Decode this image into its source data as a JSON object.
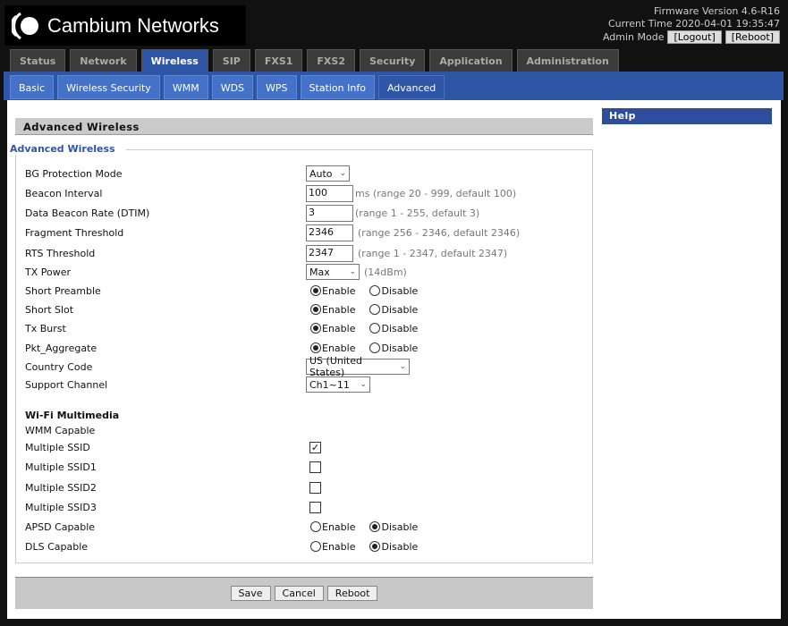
{
  "brand": {
    "name": "Cambium Networks"
  },
  "header": {
    "firmware": "Firmware Version 4.6-R16",
    "time": "Current Time 2020-04-01 19:35:47",
    "mode": "Admin Mode",
    "logout": "[Logout]",
    "reboot": "[Reboot]"
  },
  "tabs": [
    "Status",
    "Network",
    "Wireless",
    "SIP",
    "FXS1",
    "FXS2",
    "Security",
    "Application",
    "Administration"
  ],
  "active_tab": "Wireless",
  "subtabs": [
    "Basic",
    "Wireless Security",
    "WMM",
    "WDS",
    "WPS",
    "Station Info",
    "Advanced"
  ],
  "active_subtab": "Advanced",
  "section_title": "Advanced Wireless",
  "help_title": "Help",
  "fieldset_legend": "Advanced Wireless",
  "fields": {
    "bg_protection": {
      "label": "BG Protection Mode",
      "value": "Auto"
    },
    "beacon_interval": {
      "label": "Beacon Interval",
      "value": "100",
      "hint": "ms (range 20 - 999, default 100)"
    },
    "dtim": {
      "label": "Data Beacon Rate (DTIM)",
      "value": "3",
      "hint": "(range 1 - 255, default 3)"
    },
    "fragment": {
      "label": "Fragment Threshold",
      "value": "2346",
      "hint": "(range 256 - 2346, default 2346)"
    },
    "rts": {
      "label": "RTS Threshold",
      "value": "2347",
      "hint": "(range 1 - 2347, default 2347)"
    },
    "tx_power": {
      "label": "TX Power",
      "value": "Max",
      "hint": "(14dBm)"
    },
    "short_preamble": {
      "label": "Short Preamble",
      "value": "Enable"
    },
    "short_slot": {
      "label": "Short Slot",
      "value": "Enable"
    },
    "tx_burst": {
      "label": "Tx Burst",
      "value": "Enable"
    },
    "pkt_aggregate": {
      "label": "Pkt_Aggregate",
      "value": "Enable"
    },
    "country_code": {
      "label": "Country Code",
      "value": "US (United States)"
    },
    "support_channel": {
      "label": "Support Channel",
      "value": "Ch1~11"
    }
  },
  "radio_labels": {
    "enable": "Enable",
    "disable": "Disable"
  },
  "wmm": {
    "heading": "Wi-Fi Multimedia",
    "capable_label": "WMM Capable",
    "multiple_ssid": {
      "label": "Multiple SSID",
      "checked": true
    },
    "multiple_ssid1": {
      "label": "Multiple SSID1",
      "checked": false
    },
    "multiple_ssid2": {
      "label": "Multiple SSID2",
      "checked": false
    },
    "multiple_ssid3": {
      "label": "Multiple SSID3",
      "checked": false
    },
    "apsd": {
      "label": "APSD Capable",
      "value": "Disable"
    },
    "dls": {
      "label": "DLS Capable",
      "value": "Disable"
    }
  },
  "buttons": {
    "save": "Save",
    "cancel": "Cancel",
    "reboot": "Reboot"
  }
}
